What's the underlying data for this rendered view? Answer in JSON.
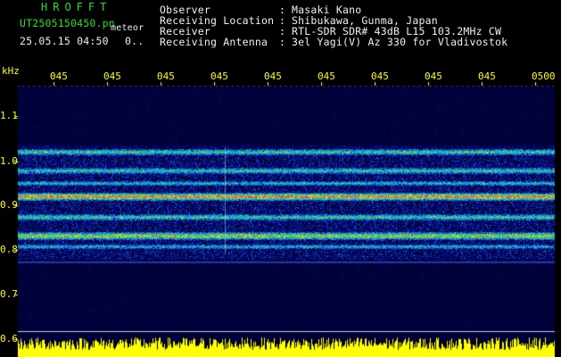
{
  "header": {
    "brand": "HROFFT",
    "filename": "UT2505150450.pn",
    "mode": "meteor",
    "datetime": "25.05.15 04:50",
    "count": "0..",
    "fields": [
      {
        "label": "Observer",
        "value": "Masaki Kano"
      },
      {
        "label": "Receiving Location",
        "value": "Shibukawa, Gunma, Japan"
      },
      {
        "label": "Receiver",
        "value": "RTL-SDR SDR# 43dB L15 103.2MHz CW"
      },
      {
        "label": "Receiving Antenna",
        "value": "3el Yagi(V) Az 330 for Vladivostok"
      }
    ]
  },
  "axis": {
    "unit": "kHz",
    "x_ticks": [
      "045",
      "045",
      "045",
      "045",
      "045",
      "045",
      "045",
      "045",
      "045",
      "0500"
    ],
    "y_ticks": [
      "1.1",
      "1.0",
      "0.9",
      "0.8",
      "0.7",
      "0.6"
    ]
  },
  "colors": {
    "background": "#000000",
    "plot_bg": "#00003c",
    "text_green": "#22e01e",
    "text_white": "#f0f0f0",
    "axis_yellow": "#ffff00"
  }
}
